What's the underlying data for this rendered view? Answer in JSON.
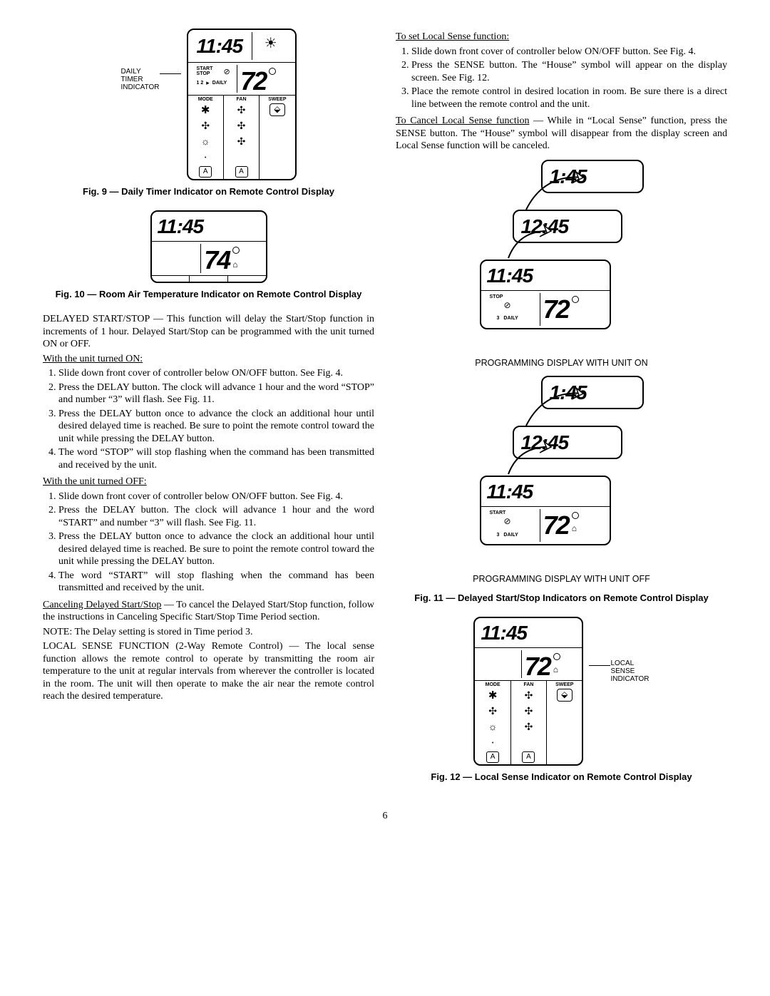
{
  "fig9": {
    "label_left": "DAILY\nTIMER\nINDICATOR",
    "time": "11:45",
    "start": "START",
    "stop": "STOP",
    "daily": "DAILY",
    "nums": "1  2",
    "temp": "72",
    "mode_h": "MODE",
    "fan_h": "FAN",
    "sweep_h": "SWEEP",
    "a": "A",
    "caption": "Fig. 9 — Daily Timer Indicator on Remote Control Display"
  },
  "fig10": {
    "time": "11:45",
    "temp": "74",
    "caption": "Fig. 10 — Room Air Temperature Indicator on Remote Control Display"
  },
  "body_left": {
    "p1": "DELAYED START/STOP — This function will delay the Start/Stop function in increments of 1 hour. Delayed Start/Stop can be programmed with the unit turned ON or OFF.",
    "h_on": "With the unit turned ON:",
    "on1": "Slide down front cover of controller below ON/OFF button. See Fig. 4.",
    "on2": "Press the DELAY button. The clock will advance 1 hour and the word “STOP” and number “3” will flash. See Fig. 11.",
    "on3": "Press the DELAY button once to advance the clock an additional hour until desired delayed time is reached. Be sure to point the remote control toward the unit while pressing the DELAY button.",
    "on4": "The word “STOP” will stop flashing when the command has been transmitted and received by the unit.",
    "h_off": "With the unit turned OFF:",
    "off1": "Slide down front cover of controller below ON/OFF button. See Fig. 4.",
    "off2": "Press the DELAY button. The clock will advance 1 hour and the word “START” and number “3” will flash. See Fig. 11.",
    "off3": "Press the DELAY button once to advance the clock an additional hour until desired delayed time is reached. Be sure to point the remote control toward the unit while pressing the DELAY button.",
    "off4": "The word “START” will stop flashing when the command has been transmitted and received by the unit.",
    "p_cancel": "Canceling Delayed Start/Stop — To cancel the Delayed Start/Stop function, follow the instructions in Canceling Specific Start/Stop Time Period section.",
    "p_cancel_u": "Canceling Delayed Start/Stop",
    "p_note": "NOTE: The Delay setting is stored in Time period 3.",
    "p_local": "LOCAL SENSE FUNCTION (2-Way Remote Control) — The local sense function allows the remote control to operate by transmitting the room air temperature to the unit at regular intervals from wherever the controller is located in the room. The unit will then operate to make the air near the remote control reach the desired temperature."
  },
  "body_right": {
    "h_set": "To set Local Sense function:",
    "s1": "Slide down front cover of controller below ON/OFF button. See Fig. 4.",
    "s2": "Press the SENSE button. The “House” symbol will appear on the display screen. See Fig. 12.",
    "s3": "Place the remote control in desired location in room. Be sure there is a direct line between the remote control and the unit.",
    "p_cancel_ls": "To Cancel Local Sense function — While in “Local Sense” function, press the SENSE button. The “House” symbol will disappear from the display screen and Local Sense function will be canceled.",
    "p_cancel_ls_u": "To Cancel Local Sense function"
  },
  "fig11": {
    "t1": "1:45",
    "t2": "12:45",
    "t3": "11:45",
    "stop": "STOP",
    "start": "START",
    "num": "3",
    "daily": "DAILY",
    "temp": "72",
    "sub_on": "PROGRAMMING DISPLAY WITH UNIT ON",
    "sub_off": "PROGRAMMING DISPLAY WITH UNIT OFF",
    "caption": "Fig. 11 — Delayed Start/Stop Indicators on Remote Control Display"
  },
  "fig12": {
    "time": "11:45",
    "temp": "72",
    "mode_h": "MODE",
    "fan_h": "FAN",
    "sweep_h": "SWEEP",
    "a": "A",
    "label_right": "LOCAL\nSENSE\nINDICATOR",
    "caption": "Fig. 12 — Local Sense Indicator on Remote Control Display"
  },
  "page_number": "6"
}
